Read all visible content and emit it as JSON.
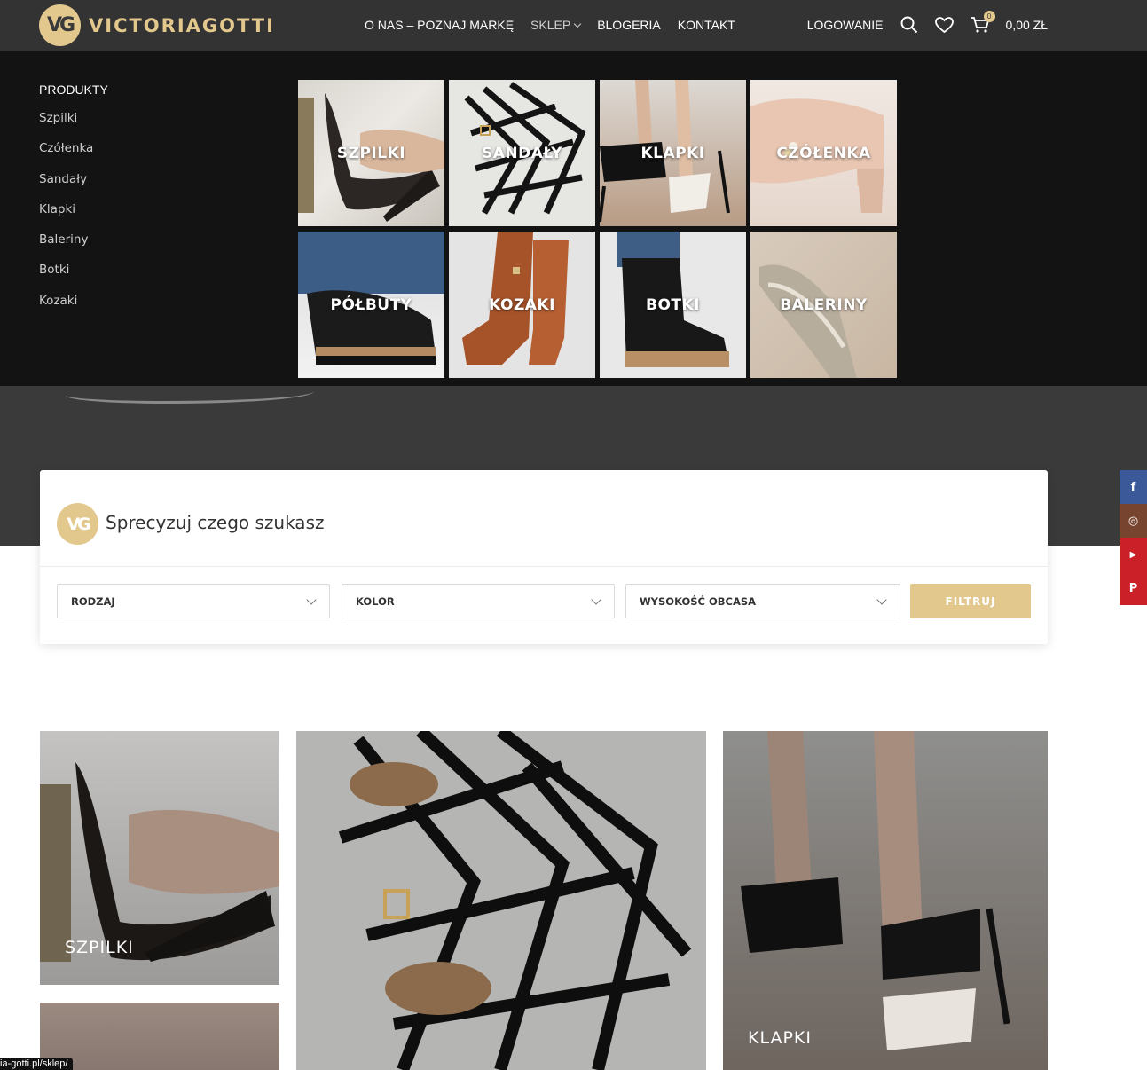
{
  "brand": {
    "logo_mark": "VG",
    "name": "VICTORIAGOTTI"
  },
  "nav": {
    "items": [
      {
        "label": "O NAS – POZNAJ MARKĘ"
      },
      {
        "label": "SKLEP"
      },
      {
        "label": "BLOGERIA"
      },
      {
        "label": "KONTAKT"
      }
    ],
    "login_label": "LOGOWANIE",
    "cart_count": "0",
    "cart_total": "0,00 ZŁ",
    "icons": [
      "search-icon",
      "heart-icon",
      "cart-icon"
    ]
  },
  "mega_menu": {
    "title": "PRODUKTY",
    "items": [
      "Szpilki",
      "Czółenka",
      "Sandały",
      "Klapki",
      "Baleriny",
      "Botki",
      "Kozaki"
    ],
    "tiles": [
      "SZPILKI",
      "SANDAŁY",
      "KLAPKI",
      "CZÓŁENKA",
      "PÓŁBUTY",
      "KOZAKI",
      "BOTKI",
      "BALERINY"
    ]
  },
  "filter": {
    "logo_mark": "VG",
    "title": "Sprecyzuj czego szukasz",
    "selects": [
      "RODZAJ",
      "KOLOR",
      "WYSOKOŚĆ OBCASA"
    ],
    "button": "FILTRUJ"
  },
  "social": [
    {
      "name": "facebook-icon",
      "glyph": "f",
      "color": "#3b5998"
    },
    {
      "name": "instagram-icon",
      "glyph": "◎",
      "color": "#774430"
    },
    {
      "name": "youtube-icon",
      "glyph": "▶",
      "color": "#cb2027"
    },
    {
      "name": "pinterest-icon",
      "glyph": "P",
      "color": "#cb2027"
    }
  ],
  "categories": [
    {
      "label": "SZPILKI"
    },
    {
      "label": "KLAPKI"
    }
  ],
  "status_url": "ia-gotti.pl/sklep/",
  "colors": {
    "gold": "#e3c88e",
    "header": "#333333",
    "mega_bg": "#131313"
  }
}
